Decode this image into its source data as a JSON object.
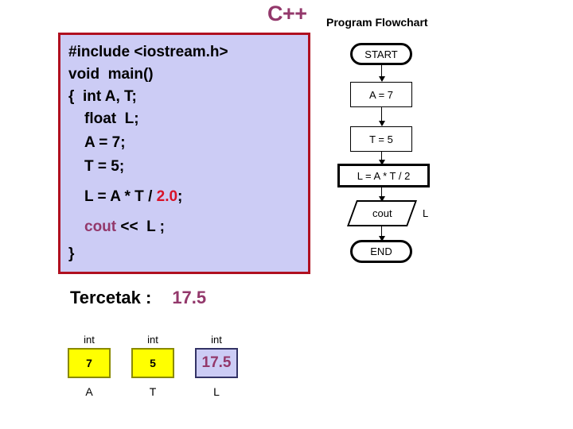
{
  "header": {
    "logo": "C++",
    "flowchart_title": "Program Flowchart",
    "logo_color": "#93386b"
  },
  "code_panel": {
    "border_color": "#b01020",
    "background_color": "#ccccf5",
    "lines": [
      {
        "text": "#include <iostream.h>",
        "indent": 0
      },
      {
        "text": "void  main()",
        "indent": 0
      },
      {
        "text": "{  int A, T;",
        "indent": 0
      },
      {
        "text": "float  L;",
        "indent": 1
      },
      {
        "text": "A = 7;",
        "indent": 2,
        "color": "maroon"
      },
      {
        "text": "T = 5;",
        "indent": 2,
        "color": "maroon"
      },
      {
        "text": "L = A * T / 2.0;",
        "indent": 2,
        "highlight": "2.0"
      },
      {
        "text": "cout << L ;",
        "indent": 2,
        "highlight_prefix": "cout"
      },
      {
        "text": "}",
        "indent": 0
      }
    ],
    "segments": {
      "line7_plain_a": "L = A * T / ",
      "line7_red": "2.0",
      "line7_plain_b": ";",
      "line8_maroon": "cout",
      "line8_plain": " <<  L ;"
    }
  },
  "flowchart": {
    "nodes": [
      {
        "id": "start",
        "shape": "terminal",
        "label": "START"
      },
      {
        "id": "assign_a",
        "shape": "process",
        "label": "A = 7"
      },
      {
        "id": "assign_t",
        "shape": "process",
        "label": "T = 5"
      },
      {
        "id": "compute_l",
        "shape": "process-bold",
        "label": "L = A * T / 2"
      },
      {
        "id": "output",
        "shape": "io",
        "label": "cout"
      },
      {
        "id": "end",
        "shape": "terminal",
        "label": "END"
      }
    ],
    "side_label": "L"
  },
  "output": {
    "label": "Tercetak :",
    "value": "17.5",
    "value_color": "#93386b"
  },
  "variables": [
    {
      "type": "int",
      "value": "7",
      "name": "A",
      "style": "int"
    },
    {
      "type": "int",
      "value": "5",
      "name": "T",
      "style": "int"
    },
    {
      "type": "int",
      "value": "17.5",
      "name": "L",
      "style": "float"
    }
  ]
}
